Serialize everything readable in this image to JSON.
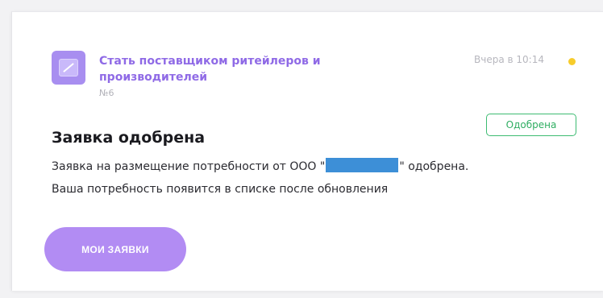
{
  "notification": {
    "service_title": "Стать поставщиком ритейлеров и производителей",
    "number": "№6",
    "timestamp": "Вчера в 10:14",
    "heading": "Заявка одобрена",
    "status_badge": "Одобрена",
    "message": {
      "before_redaction": "Заявка на размещение потребности от ООО \"",
      "after_redaction": "\" одобрена.",
      "line2": "Ваша потребность появится в списке после обновления"
    },
    "button_label": "МОИ ЗАЯВКИ"
  },
  "colors": {
    "accent": "#b28cf3",
    "title": "#8f6ae6",
    "success": "#2fae62",
    "unread_dot": "#f7cc2b",
    "redaction": "#3d8fd7"
  },
  "icons": {
    "app_icon": "image-icon",
    "unread_indicator": "dot-icon"
  }
}
